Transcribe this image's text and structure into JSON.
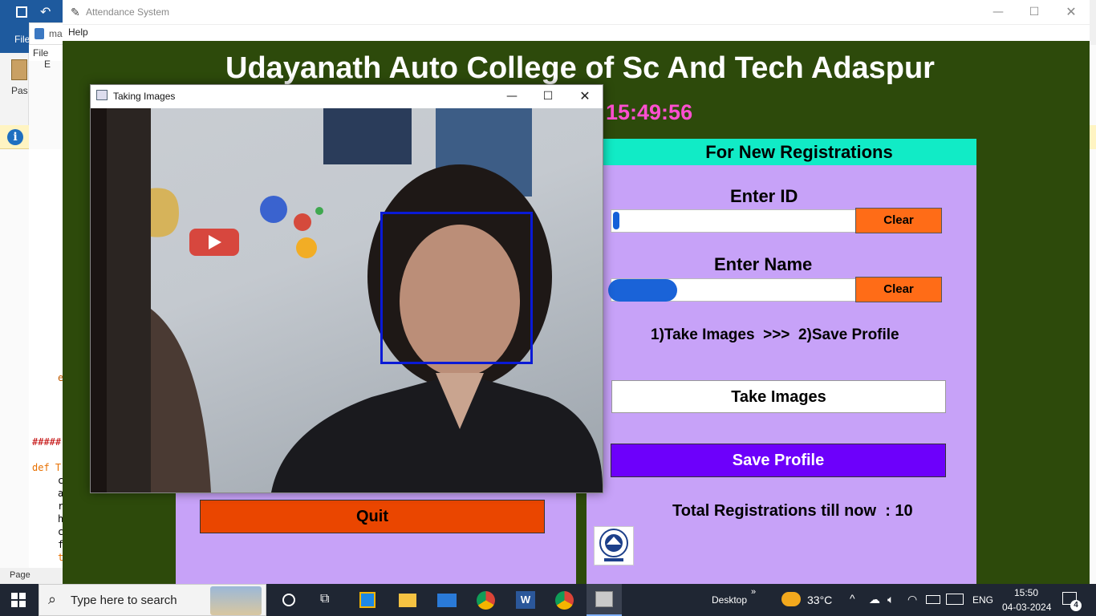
{
  "background_app": {
    "ribbon_tab": "File",
    "editor_tab": "ma",
    "menu_file": "File",
    "menu_edit_fragment": "E",
    "paste_label": "Pas",
    "code_fragments": {
      "line_e": "e",
      "hashes": "#####",
      "def_line": "def T",
      "lines": [
        "c",
        "a",
        "r",
        "h",
        "c",
        "f",
        "t"
      ]
    },
    "status": "Page"
  },
  "main_window": {
    "title": "Attendance System",
    "menu": [
      "Help"
    ],
    "heading": "Udayanath Auto College of Sc And Tech Adaspur",
    "clock": "15:49:56",
    "colors": {
      "background": "#2d4a0b",
      "heading": "#ffffff",
      "clock": "#ff4fd1",
      "panel": "#c7a2f8",
      "header": "#11ebc6"
    }
  },
  "registration": {
    "header": "For New Registrations",
    "id_label": "Enter ID",
    "id_value": "",
    "name_label": "Enter Name",
    "name_value": "",
    "clear_label": "Clear",
    "steps": "1)Take Images  >>>  2)Save Profile",
    "take_images": "Take Images",
    "save_profile": "Save Profile",
    "total": "Total Registrations till now  : 10",
    "colors": {
      "clear": "#ff6c17",
      "save": "#6d00fb"
    }
  },
  "left_panel": {
    "quit": "Quit",
    "quit_color": "#ea4600"
  },
  "camera_window": {
    "title": "Taking Images",
    "face_box_color": "#0a1ad6"
  },
  "taskbar": {
    "search_placeholder": "Type here to search",
    "desktop": "Desktop",
    "temperature": "33°C",
    "language": "ENG",
    "time": "15:50",
    "date": "04-03-2024",
    "notification_count": "4",
    "apps": [
      "cortana-icon",
      "task-view-icon",
      "store-icon",
      "file-explorer-icon",
      "mail-icon",
      "chrome-icon",
      "word-icon",
      "chrome-icon",
      "python-app-icon"
    ]
  }
}
